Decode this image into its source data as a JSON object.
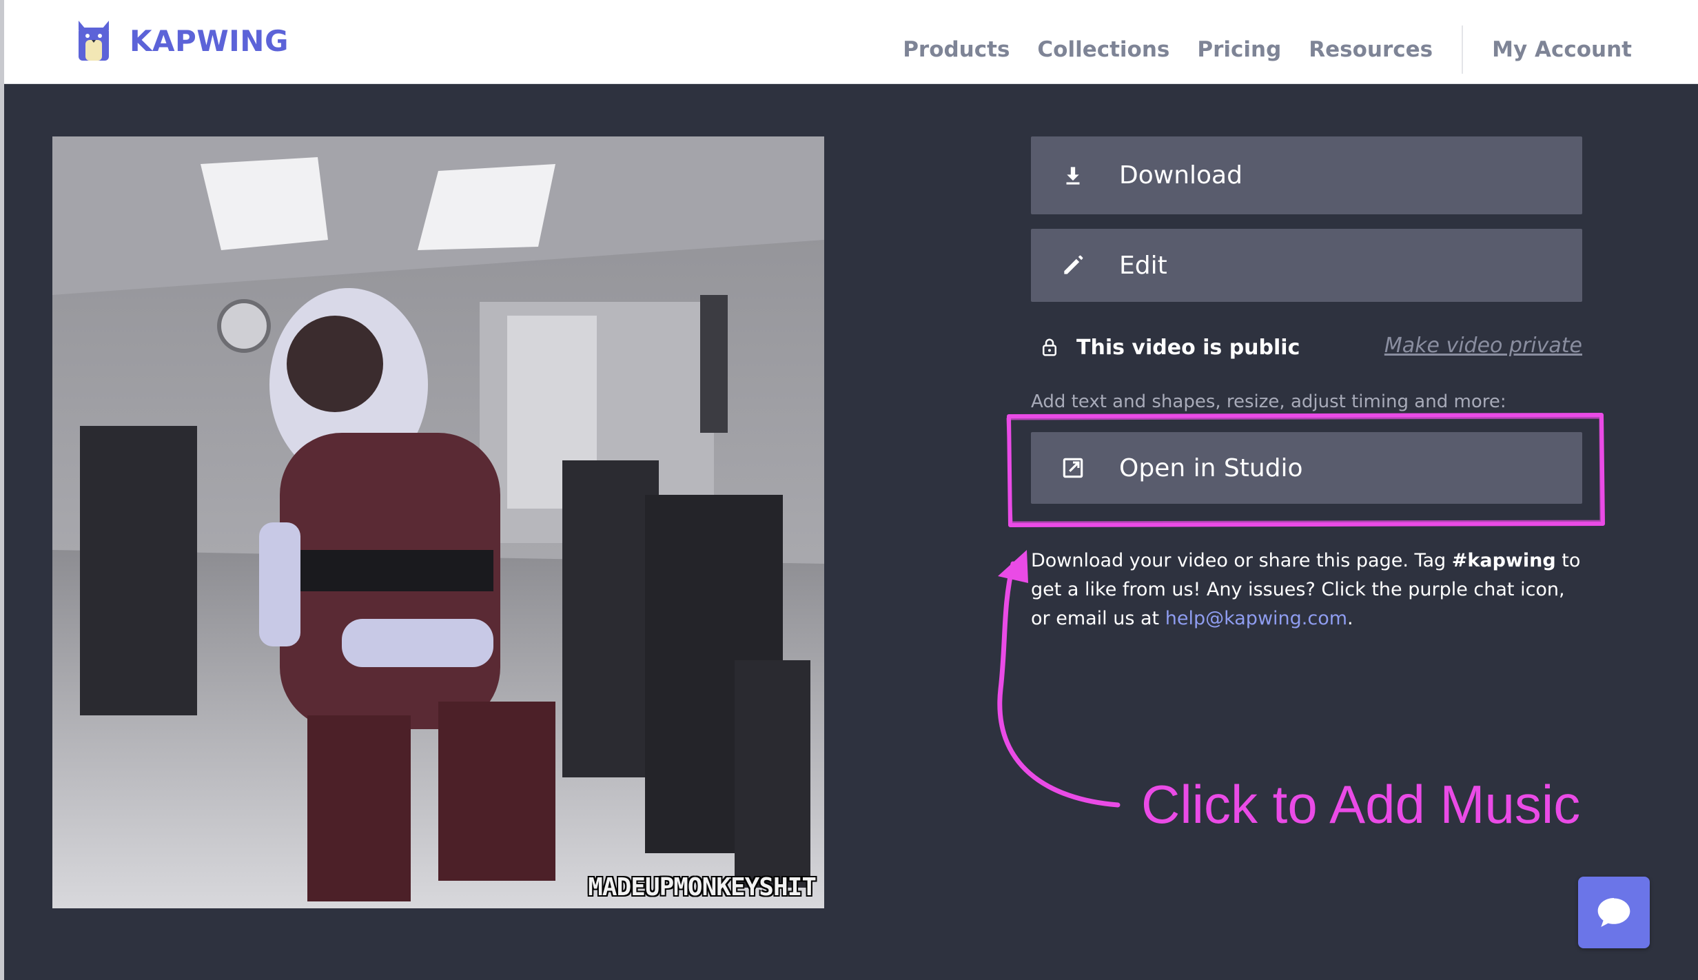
{
  "header": {
    "logo_text": "KAPWING",
    "nav": [
      "Products",
      "Collections",
      "Pricing",
      "Resources"
    ],
    "account": "My Account"
  },
  "video": {
    "watermark": "MADEUPMONKEYSHIT"
  },
  "actions": {
    "download_label": "Download",
    "edit_label": "Edit",
    "public_status": "This video is public",
    "make_private": "Make video private",
    "studio_hint": "Add text and shapes, resize, adjust timing and more:",
    "open_studio_label": "Open in Studio"
  },
  "info": {
    "part1": "Download your video or share this page. Tag ",
    "tag": "#kapwing",
    "part2": " to get a like from us! Any issues? Click the purple chat icon, or email us at ",
    "email": "help@kapwing.com",
    "part3": "."
  },
  "annotation": {
    "text": "Click to Add Music",
    "color": "#ea4be6"
  },
  "colors": {
    "brand": "#5c63d8",
    "background": "#2e323f",
    "button": "#595c6d",
    "chat": "#6b75e8"
  },
  "icons": [
    "kapwing-cat-icon",
    "download-icon",
    "pencil-icon",
    "lock-icon",
    "external-link-icon",
    "chat-bubble-icon"
  ]
}
